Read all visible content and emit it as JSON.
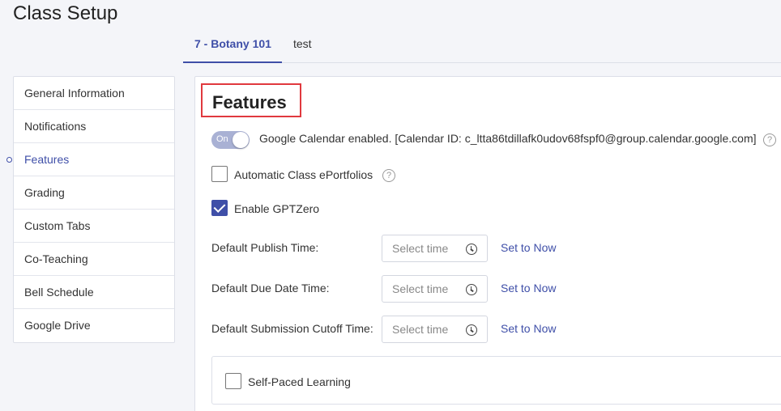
{
  "page": {
    "title": "Class Setup"
  },
  "tabs": [
    {
      "label": "7 - Botany 101",
      "active": true
    },
    {
      "label": "test",
      "active": false
    }
  ],
  "sidebar": {
    "items": [
      {
        "label": "General Information"
      },
      {
        "label": "Notifications"
      },
      {
        "label": "Features"
      },
      {
        "label": "Grading"
      },
      {
        "label": "Custom Tabs"
      },
      {
        "label": "Co-Teaching"
      },
      {
        "label": "Bell Schedule"
      },
      {
        "label": "Google Drive"
      }
    ]
  },
  "features": {
    "title": "Features",
    "google_calendar": {
      "toggle_label": "On",
      "text": "Google Calendar enabled. [Calendar ID: c_ltta86tdillafk0udov68fspf0@group.calendar.google.com]"
    },
    "eportfolios": {
      "label": "Automatic Class ePortfolios",
      "checked": false
    },
    "gptzero": {
      "label": "Enable GPTZero",
      "checked": true
    },
    "publish_time": {
      "label": "Default Publish Time:",
      "placeholder": "Select time",
      "set_now": "Set to Now"
    },
    "due_date_time": {
      "label": "Default Due Date Time:",
      "placeholder": "Select time",
      "set_now": "Set to Now"
    },
    "cutoff_time": {
      "label": "Default Submission Cutoff Time:",
      "placeholder": "Select time",
      "set_now": "Set to Now"
    },
    "self_paced": {
      "label": "Self-Paced Learning",
      "checked": false
    }
  },
  "icons": {
    "help": "?"
  },
  "colors": {
    "accent": "#3f4fa8",
    "highlight_border": "#e0393e",
    "toggle_on": "#a9b1d4"
  }
}
